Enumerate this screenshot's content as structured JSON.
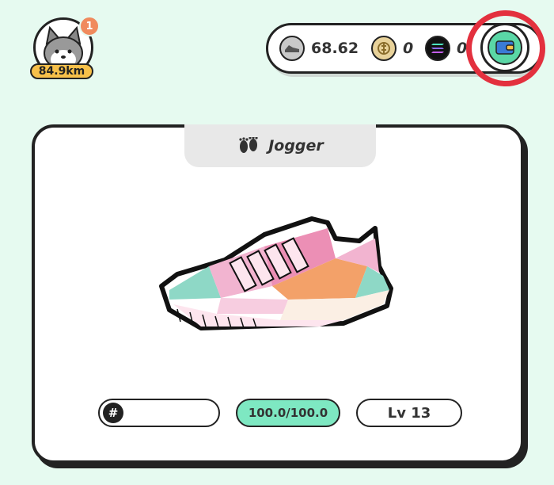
{
  "profile": {
    "notification_count": "1",
    "distance": "84.9km"
  },
  "balances": {
    "gst": "68.62",
    "gmt": "0",
    "sol": "0"
  },
  "sneaker": {
    "type": "Jogger",
    "id": "",
    "durability": "100.0/100.0",
    "level": "Lv 13"
  },
  "colors": {
    "background": "#e6faf0",
    "accent_green": "#7ee8c2",
    "highlight_ring": "#e3303e",
    "badge_orange": "#f08a5d",
    "distance_yellow": "#f7c04a"
  },
  "icons": {
    "profile": "shiba-dog-avatar",
    "gst": "sneaker-coin-icon",
    "gmt": "gmt-coin-icon",
    "sol": "solana-icon",
    "wallet": "wallet-icon",
    "type": "footprints-icon",
    "id": "hash-icon"
  }
}
